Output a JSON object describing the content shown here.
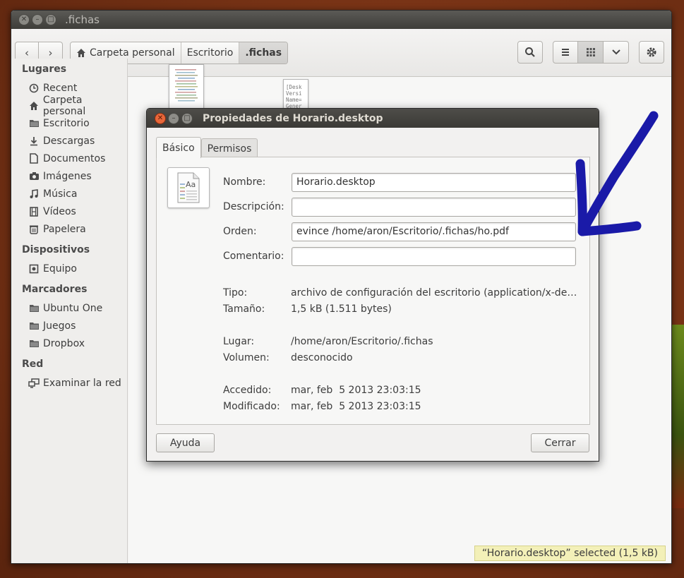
{
  "window": {
    "title": ".fichas",
    "back_icon": "chevron-left-icon",
    "forward_icon": "chevron-right-icon",
    "breadcrumbs": [
      "Carpeta personal",
      "Escritorio",
      ".fichas"
    ],
    "search_icon": "search-icon",
    "view_icons": [
      "list-view-icon",
      "grid-view-icon",
      "chevron-down-icon"
    ],
    "settings_icon": "gear-icon"
  },
  "sidebar": {
    "sections": [
      {
        "heading": "Lugares",
        "items": [
          {
            "label": "Recent",
            "icon": "clock-icon"
          },
          {
            "label": "Carpeta personal",
            "icon": "home-icon"
          },
          {
            "label": "Escritorio",
            "icon": "folder-icon"
          },
          {
            "label": "Descargas",
            "icon": "download-icon"
          },
          {
            "label": "Documentos",
            "icon": "document-icon"
          },
          {
            "label": "Imágenes",
            "icon": "camera-icon"
          },
          {
            "label": "Música",
            "icon": "music-icon"
          },
          {
            "label": "Vídeos",
            "icon": "film-icon"
          },
          {
            "label": "Papelera",
            "icon": "trash-icon"
          }
        ]
      },
      {
        "heading": "Dispositivos",
        "items": [
          {
            "label": "Equipo",
            "icon": "computer-icon"
          }
        ]
      },
      {
        "heading": "Marcadores",
        "items": [
          {
            "label": "Ubuntu One",
            "icon": "folder-icon"
          },
          {
            "label": "Juegos",
            "icon": "folder-icon"
          },
          {
            "label": "Dropbox",
            "icon": "folder-icon"
          }
        ]
      },
      {
        "heading": "Red",
        "items": [
          {
            "label": "Examinar la red",
            "icon": "network-icon"
          }
        ]
      }
    ]
  },
  "files": {
    "desktop_preview_lines": [
      "[Desk",
      "Versi",
      "Name=",
      "Gener"
    ]
  },
  "status_bar": "“Horario.desktop” selected  (1,5 kB)",
  "dialog": {
    "title": "Propiedades de Horario.desktop",
    "tabs": [
      "Básico",
      "Permisos"
    ],
    "icon_label": "Aa",
    "fields": {
      "nombre": {
        "label": "Nombre:",
        "value": "Horario.desktop"
      },
      "descripcion": {
        "label": "Descripción:",
        "value": ""
      },
      "orden": {
        "label": "Orden:",
        "value": "evince /home/aron/Escritorio/.fichas/ho.pdf"
      },
      "comentario": {
        "label": "Comentario:",
        "value": ""
      }
    },
    "info": {
      "tipo": {
        "label": "Tipo:",
        "value": "archivo de configuración del escritorio (application/x-des…"
      },
      "tamano": {
        "label": "Tamaño:",
        "value": "1,5 kB (1.511 bytes)"
      },
      "lugar": {
        "label": "Lugar:",
        "value": "/home/aron/Escritorio/.fichas"
      },
      "volumen": {
        "label": "Volumen:",
        "value": "desconocido"
      },
      "accedido": {
        "label": "Accedido:",
        "value": "mar, feb  5 2013 23:03:15"
      },
      "modificado": {
        "label": "Modificado:",
        "value": "mar, feb  5 2013 23:03:15"
      }
    },
    "buttons": {
      "help": "Ayuda",
      "close": "Cerrar"
    }
  },
  "colors": {
    "annotation_arrow": "#1a1aa8",
    "dialog_close_button": "#e8673a",
    "status_bg": "#f3f0b8"
  }
}
